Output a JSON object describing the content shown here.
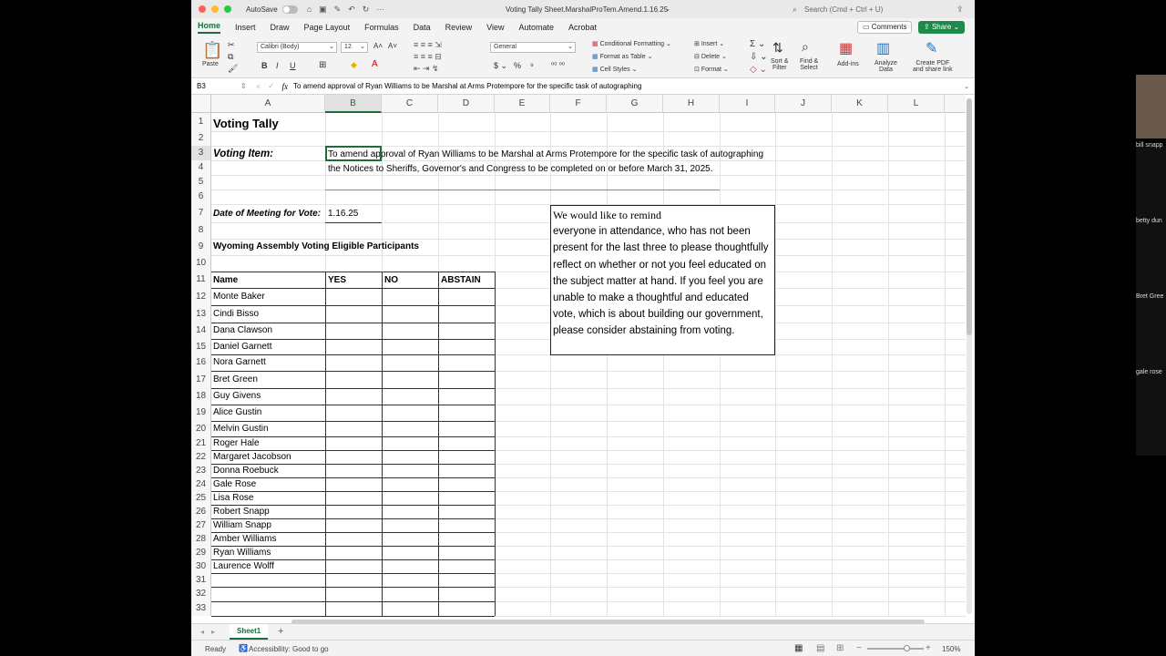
{
  "window": {
    "autosave_label": "AutoSave",
    "title": "Voting Tally Sheet.MarshalProTem.Amend.1.16.25",
    "search_placeholder": "Search (Cmd + Ctrl + U)"
  },
  "ribbon_tabs": [
    "Home",
    "Insert",
    "Draw",
    "Page Layout",
    "Formulas",
    "Data",
    "Review",
    "View",
    "Automate",
    "Acrobat"
  ],
  "ribbon": {
    "comments_label": "Comments",
    "share_label": "Share",
    "paste_label": "Paste",
    "font_name": "Calibri (Body)",
    "font_size": "12",
    "number_format": "General",
    "conditional_formatting": "Conditional Formatting",
    "format_as_table": "Format as Table",
    "cell_styles": "Cell Styles",
    "insert": "Insert",
    "delete": "Delete",
    "format": "Format",
    "sort_filter": "Sort &\nFilter",
    "find_select": "Find &\nSelect",
    "add_ins": "Add-ins",
    "analyze_data": "Analyze\nData",
    "create_pdf": "Create PDF\nand share link"
  },
  "formula_bar": {
    "name_box": "B3",
    "fx": "fx",
    "content": "To amend approval of Ryan Williams to be Marshal at Arms Protempore for the specific task of autographing"
  },
  "columns": [
    "A",
    "B",
    "C",
    "D",
    "E",
    "F",
    "G",
    "H",
    "I",
    "J",
    "K",
    "L"
  ],
  "rows": [
    "1",
    "2",
    "3",
    "4",
    "5",
    "6",
    "7",
    "8",
    "9",
    "10",
    "11",
    "12",
    "13",
    "14",
    "15",
    "16",
    "17",
    "18",
    "19",
    "20",
    "21",
    "22",
    "23",
    "24",
    "25",
    "26",
    "27",
    "28",
    "29",
    "30",
    "31",
    "32",
    "33"
  ],
  "sheet": {
    "title": "Voting Tally",
    "voting_item_label": "Voting Item:",
    "voting_item_line1": "To amend approval of Ryan Williams to be Marshal at Arms Protempore for the specific task of autographing",
    "voting_item_line2": "the Notices to Sheriffs, Governor's and Congress to be completed on or before March 31, 2025.",
    "date_label": "Date of Meeting for Vote:",
    "date_value": "1.16.25",
    "participants_heading": "Wyoming Assembly Voting Eligible Participants",
    "col_name": "Name",
    "col_yes": "YES",
    "col_no": "NO",
    "col_abstain": "ABSTAIN",
    "names": [
      "Monte Baker",
      "Cindi Bisso",
      "Dana Clawson",
      "Daniel Garnett",
      "Nora Garnett",
      "Bret Green",
      "Guy Givens",
      "Alice Gustin",
      "Melvin Gustin",
      "Roger Hale",
      "Margaret Jacobson",
      "Donna Roebuck",
      "Gale Rose",
      "Lisa Rose",
      "Robert Snapp",
      "William Snapp",
      "Amber Williams",
      "Ryan Williams",
      "Laurence Wolff"
    ],
    "note_first": "We would like to remind",
    "note_rest": "everyone in attendance, who has not been present for the last three to please thoughtfully reflect on whether or not you feel educated on the subject matter at hand. If you feel you are unable to make a thoughtful and educated vote, which is about building our government, please consider abstaining from voting."
  },
  "sheet_tab": "Sheet1",
  "status": {
    "ready": "Ready",
    "accessibility": "Accessibility: Good to go",
    "zoom": "150%"
  },
  "participants_panel": [
    "bill snapp",
    "betty dun",
    "Bret Gree",
    "gale rose"
  ],
  "colors": {
    "excel_green": "#1e6b3c",
    "share_green": "#1f8a4c"
  }
}
